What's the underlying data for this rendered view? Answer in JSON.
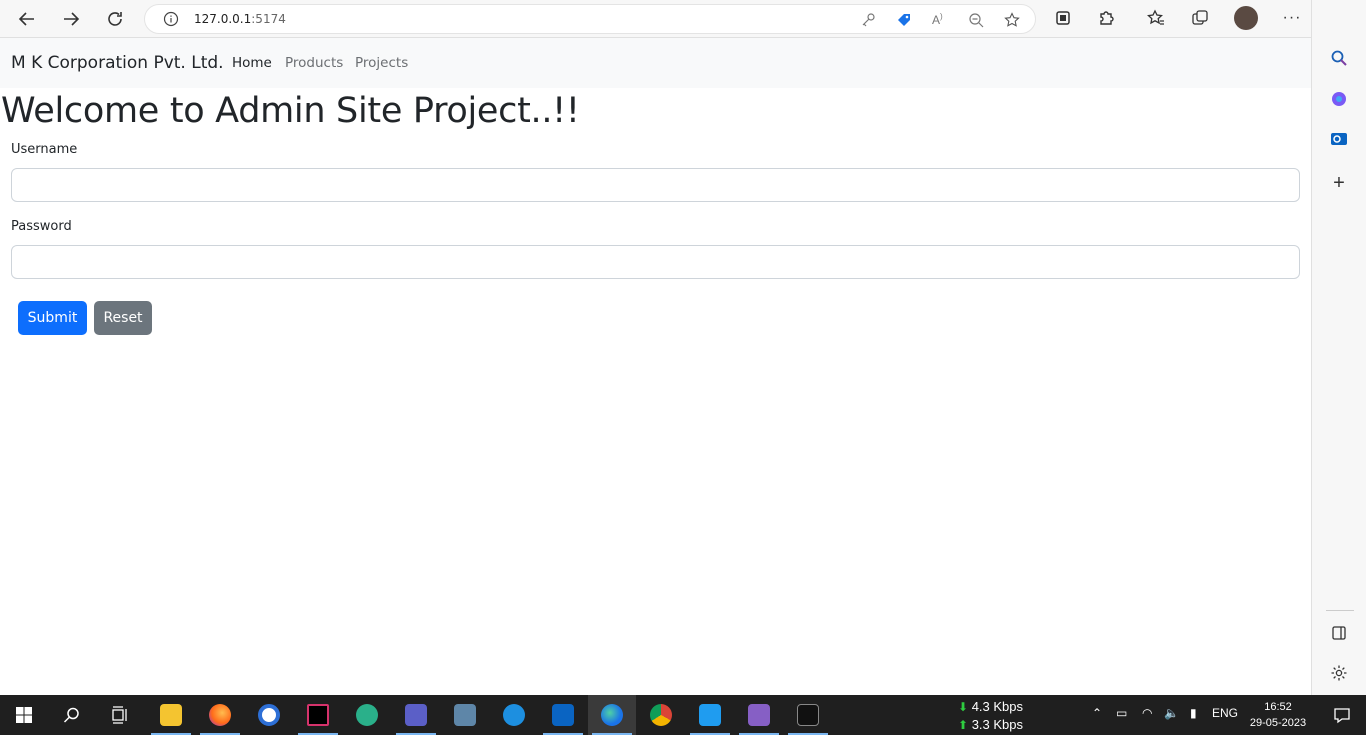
{
  "browser": {
    "url_host": "127.0.0.1",
    "url_port": ":5174"
  },
  "navbar": {
    "brand": "M K Corporation Pvt. Ltd.",
    "links": [
      {
        "label": "Home",
        "active": true
      },
      {
        "label": "Products",
        "active": false
      },
      {
        "label": "Projects",
        "active": false
      }
    ]
  },
  "main": {
    "heading": "Welcome to Admin Site Project..!!",
    "username_label": "Username",
    "username_value": "",
    "password_label": "Password",
    "password_value": "",
    "submit_label": "Submit",
    "reset_label": "Reset"
  },
  "colors": {
    "submit": "#0d6efd",
    "reset": "#6c757d",
    "navbar_bg": "#f8f9fa"
  },
  "taskbar": {
    "net_down": "4.3 Kbps",
    "net_up": "3.3 Kbps",
    "lang": "ENG",
    "time": "16:52",
    "date": "29-05-2023",
    "apps": [
      "windows-start",
      "search",
      "task-view",
      "file-explorer",
      "firefox",
      "app-w",
      "intellij",
      "app-chrome-dino",
      "teams",
      "app-tray",
      "docker",
      "outlook",
      "edge",
      "chrome",
      "vscode",
      "visual-studio",
      "terminal"
    ]
  }
}
